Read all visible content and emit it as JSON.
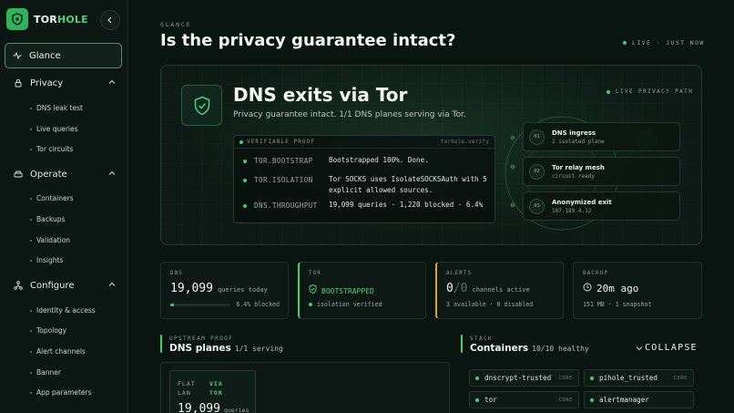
{
  "brand": {
    "name_part1": "TOR",
    "name_part2": "HOLE",
    "accent": "#2bb45a"
  },
  "sidebar": {
    "glance_label": "Glance",
    "groups": [
      {
        "label": "Privacy",
        "icon": "lock-icon",
        "items": [
          "DNS leak test",
          "Live queries",
          "Tor circuits"
        ]
      },
      {
        "label": "Operate",
        "icon": "drive-icon",
        "items": [
          "Containers",
          "Backups",
          "Validation",
          "Insights"
        ]
      },
      {
        "label": "Configure",
        "icon": "network-icon",
        "items": [
          "Identity & access",
          "Topology",
          "Alert channels",
          "Banner",
          "App parameters"
        ]
      }
    ]
  },
  "header": {
    "kicker": "GLANCE",
    "title": "Is the privacy guarantee intact?",
    "live": "LIVE · JUST NOW"
  },
  "hero": {
    "title": "DNS exits via Tor",
    "subtitle": "Privacy guarantee intact. 1/1 DNS planes serving via Tor.",
    "live_path_label": "LIVE PRIVACY PATH",
    "proof": {
      "label": "VERIFIABLE PROOF",
      "source": "torhole.verify",
      "rows": [
        {
          "key": "TOR.BOOTSTRAP",
          "value": "Bootstrapped 100%. Done."
        },
        {
          "key": "TOR.ISOLATION",
          "value": "Tor SOCKS uses IsolateSOCKSAuth with 5 explicit allowed sources."
        },
        {
          "key": "DNS.THROUGHPUT",
          "value": "19,099 queries · 1,220 blocked · 6.4%"
        }
      ]
    },
    "path": [
      {
        "num": "01",
        "title": "DNS ingress",
        "sub": "1 isolated plane"
      },
      {
        "num": "02",
        "title": "Tor relay mesh",
        "sub": "circuit ready"
      },
      {
        "num": "03",
        "title": "Anonymized exit",
        "sub": "107.189.4.12"
      }
    ]
  },
  "stats": {
    "dns": {
      "label": "DNS",
      "value": "19,099",
      "unit": "queries today",
      "foot": "6.4% blocked",
      "blocked_fraction": 0.064
    },
    "tor": {
      "label": "TOR",
      "value": "BOOTSTRAPPED",
      "foot": "isolation verified"
    },
    "alerts": {
      "label": "ALERTS",
      "value": "0",
      "sep": "/",
      "total": "0",
      "unit": "channels active",
      "foot": "3 available · 0 disabled"
    },
    "backup": {
      "label": "BACKUP",
      "value": "20m ago",
      "foot": "151 MB · 1 snapshot"
    }
  },
  "planes": {
    "kicker": "UPSTREAM PROOF",
    "title": "DNS planes",
    "count": "1/1 serving",
    "card": {
      "name_line1": "FLAT",
      "name_line2": "LAN",
      "badge_line1": "VIA",
      "badge_line2": "TOR",
      "value": "19,099",
      "unit": "queries"
    }
  },
  "stack": {
    "kicker": "STACK",
    "title": "Containers",
    "count": "10/10 healthy",
    "collapse_label": "COLLAPSE",
    "containers": [
      {
        "name": "dnscrypt-trusted",
        "tag": "CORE"
      },
      {
        "name": "pihole_trusted",
        "tag": "CORE"
      },
      {
        "name": "tor",
        "tag": "CORE"
      },
      {
        "name": "alertmanager",
        "tag": ""
      }
    ]
  }
}
